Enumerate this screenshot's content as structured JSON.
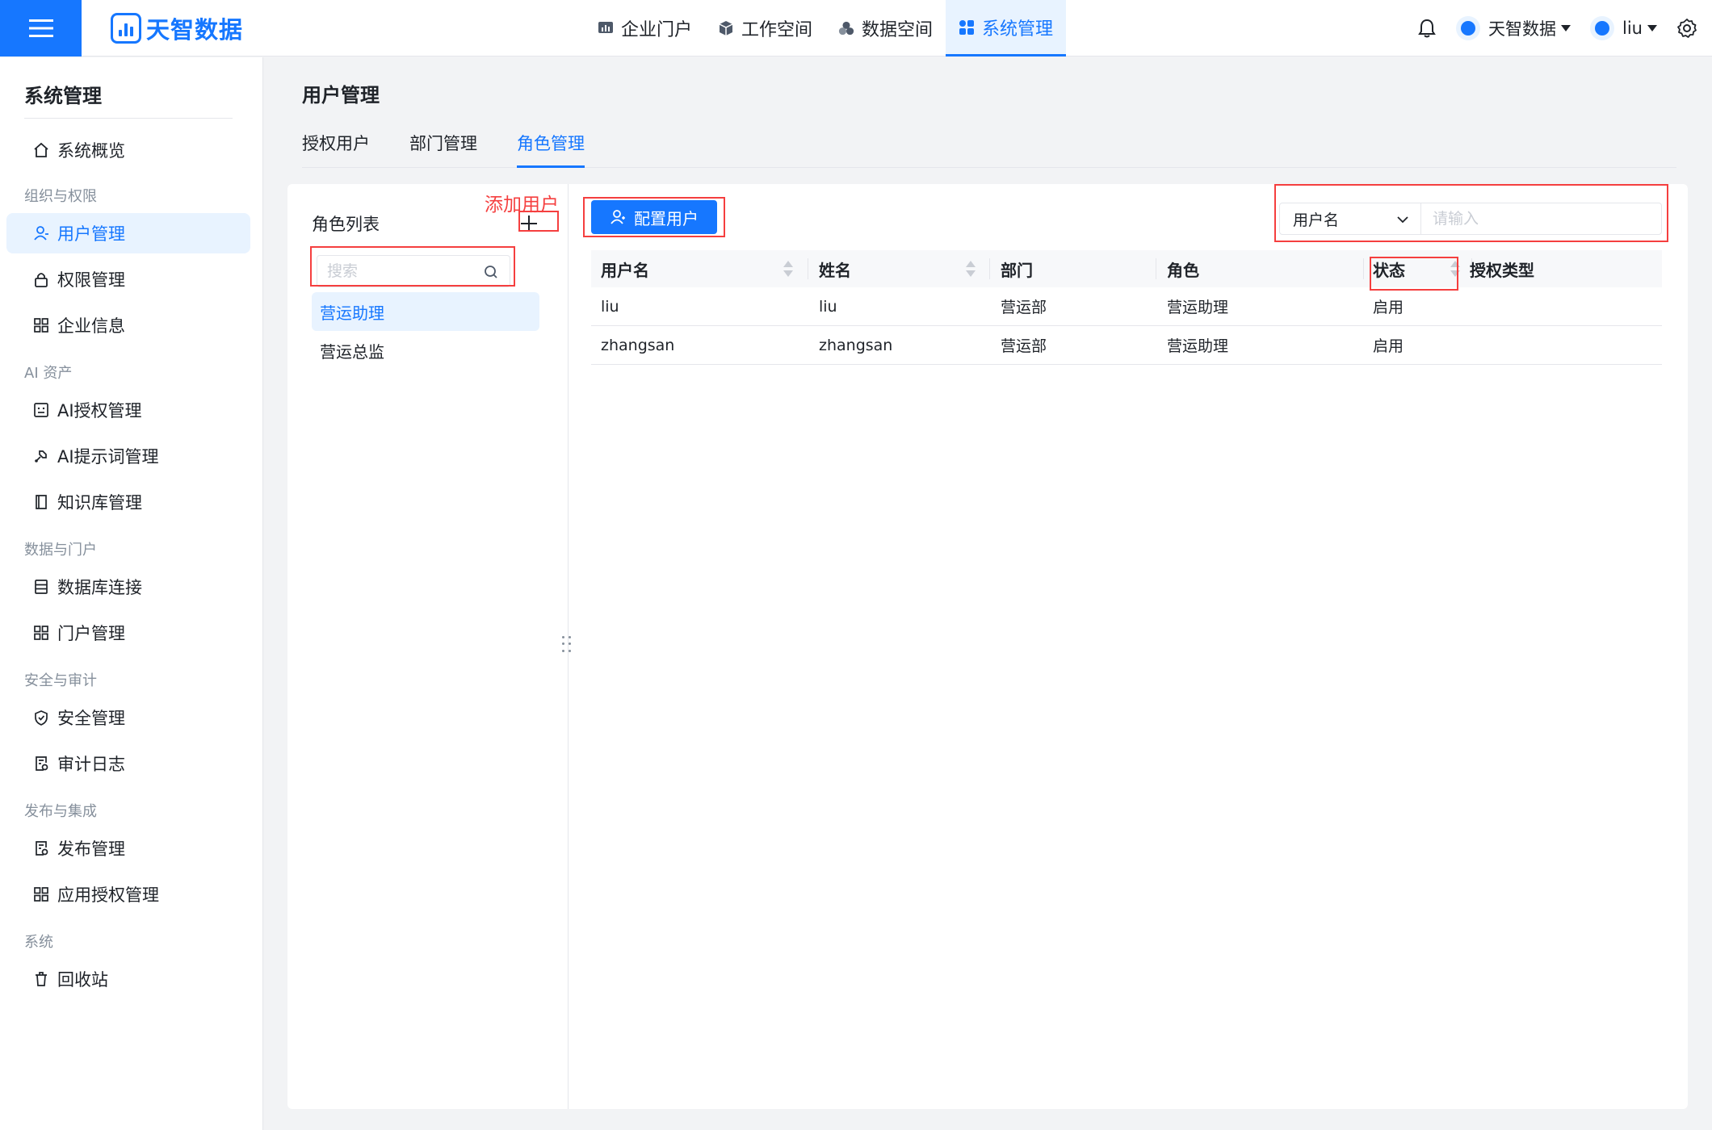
{
  "brand": {
    "name": "天智数据"
  },
  "topnav": [
    {
      "label": "企业门户",
      "icon": "chart-icon"
    },
    {
      "label": "工作空间",
      "icon": "cube-icon"
    },
    {
      "label": "数据空间",
      "icon": "cluster-icon"
    },
    {
      "label": "系统管理",
      "icon": "grid-icon",
      "active": true
    }
  ],
  "topright": {
    "org_name": "天智数据",
    "user_name": "liu"
  },
  "sidebar": {
    "title": "系统管理",
    "overview": "系统概览",
    "groups": {
      "org": "组织与权限",
      "ai": "AI 资产",
      "data": "数据与门户",
      "security": "安全与审计",
      "publish": "发布与集成",
      "system": "系统"
    },
    "items": {
      "user_mgmt": "用户管理",
      "perm_mgmt": "权限管理",
      "company_info": "企业信息",
      "ai_auth": "AI授权管理",
      "ai_prompt": "AI提示词管理",
      "knowledge": "知识库管理",
      "db_conn": "数据库连接",
      "portal_mgmt": "门户管理",
      "security_mgmt": "安全管理",
      "audit_log": "审计日志",
      "publish_mgmt": "发布管理",
      "app_auth": "应用授权管理",
      "recycle": "回收站"
    }
  },
  "page": {
    "title": "用户管理",
    "tabs": [
      "授权用户",
      "部门管理",
      "角色管理"
    ],
    "active_tab": "角色管理"
  },
  "roles": {
    "title": "角色列表",
    "add_note": "添加用户",
    "search_placeholder": "搜索",
    "items": [
      "营运助理",
      "营运总监"
    ]
  },
  "toolbar": {
    "config_button": "配置用户",
    "filter_field": "用户名",
    "filter_placeholder": "请输入"
  },
  "table": {
    "headers": [
      "用户名",
      "姓名",
      "部门",
      "角色",
      "状态",
      "授权类型"
    ],
    "rows": [
      [
        "liu",
        "liu",
        "营运部",
        "营运助理",
        "启用",
        ""
      ],
      [
        "zhangsan",
        "zhangsan",
        "营运部",
        "营运助理",
        "启用",
        ""
      ]
    ]
  },
  "colors": {
    "accent": "#1677ff",
    "annotation": "#f53f3f"
  }
}
